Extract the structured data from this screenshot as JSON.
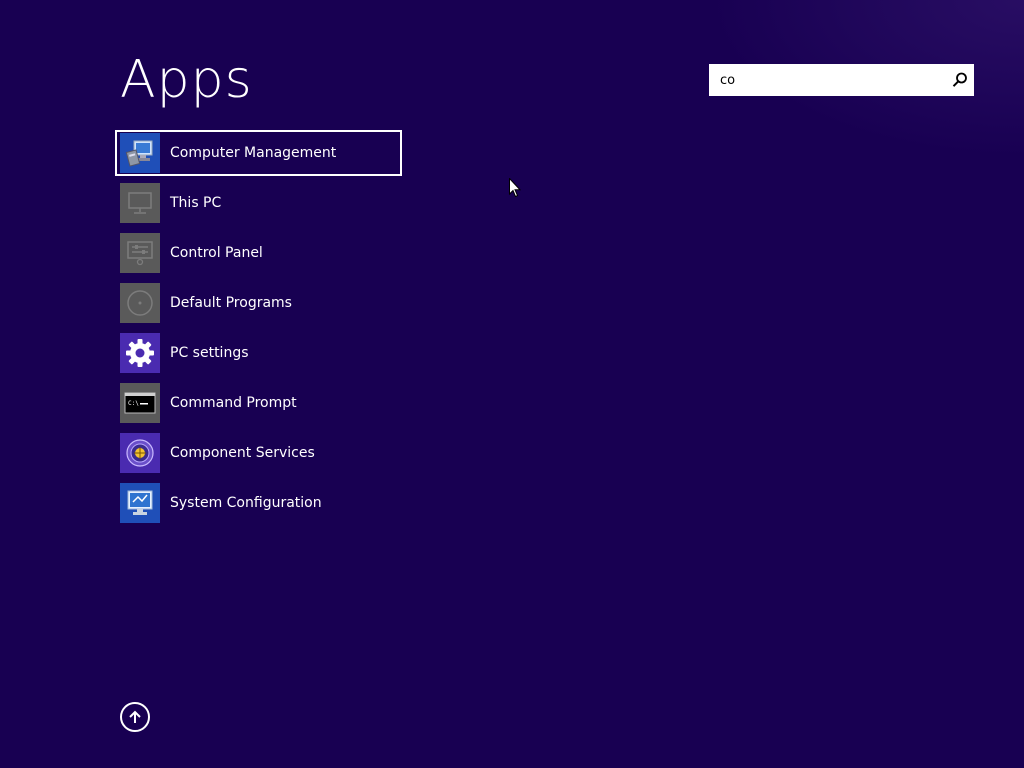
{
  "header": {
    "title": "Apps"
  },
  "search": {
    "value": "co",
    "icon": "search-icon"
  },
  "apps": [
    {
      "label": "Computer Management",
      "icon": "computer-management-icon",
      "selected": true
    },
    {
      "label": "This PC",
      "icon": "this-pc-icon",
      "selected": false
    },
    {
      "label": "Control Panel",
      "icon": "control-panel-icon",
      "selected": false
    },
    {
      "label": "Default Programs",
      "icon": "default-programs-icon",
      "selected": false
    },
    {
      "label": "PC settings",
      "icon": "gear-icon",
      "selected": false
    },
    {
      "label": "Command Prompt",
      "icon": "command-prompt-icon",
      "selected": false
    },
    {
      "label": "Component Services",
      "icon": "component-services-icon",
      "selected": false
    },
    {
      "label": "System Configuration",
      "icon": "system-configuration-icon",
      "selected": false
    }
  ],
  "footer": {
    "scroll_icon": "arrow-up-icon"
  },
  "colors": {
    "background": "#180052",
    "tile_gray": "#5a5a5a",
    "tile_purple": "#4a2bb0",
    "tile_blue": "#1f4fb8",
    "selection_border": "#ffffff"
  }
}
